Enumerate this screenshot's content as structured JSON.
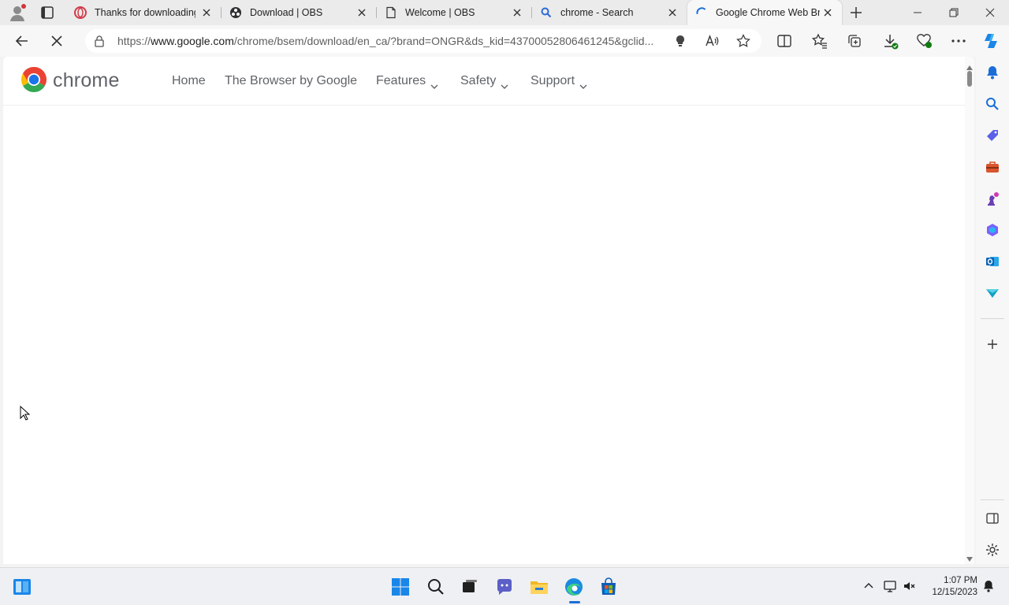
{
  "browser": {
    "tabs": [
      {
        "title": "Thanks for downloading",
        "favicon": "opera-icon",
        "active": false
      },
      {
        "title": "Download | OBS",
        "favicon": "obs-icon",
        "active": false
      },
      {
        "title": "Welcome | OBS",
        "favicon": "page-icon",
        "active": false
      },
      {
        "title": "chrome - Search",
        "favicon": "search-icon",
        "active": false
      },
      {
        "title": "Google Chrome Web Br",
        "favicon": "loading-icon",
        "active": true
      }
    ],
    "url": {
      "prefix": "https://",
      "host": "www.google.com",
      "path": "/chrome/bsem/download/en_ca/?brand=ONGR&ds_kid=43700052806461245&gclid..."
    }
  },
  "site": {
    "brand": "chrome",
    "nav": [
      {
        "label": "Home",
        "dropdown": false
      },
      {
        "label": "The Browser by Google",
        "dropdown": false
      },
      {
        "label": "Features",
        "dropdown": true
      },
      {
        "label": "Safety",
        "dropdown": true
      },
      {
        "label": "Support",
        "dropdown": true
      }
    ]
  },
  "taskbar": {
    "time": "1:07 PM",
    "date": "12/15/2023"
  },
  "colors": {
    "accent": "#1a6ed8",
    "chrome_red": "#ea4335",
    "chrome_yellow": "#fbbc04",
    "chrome_green": "#34a853",
    "chrome_blue": "#1a73e8"
  }
}
